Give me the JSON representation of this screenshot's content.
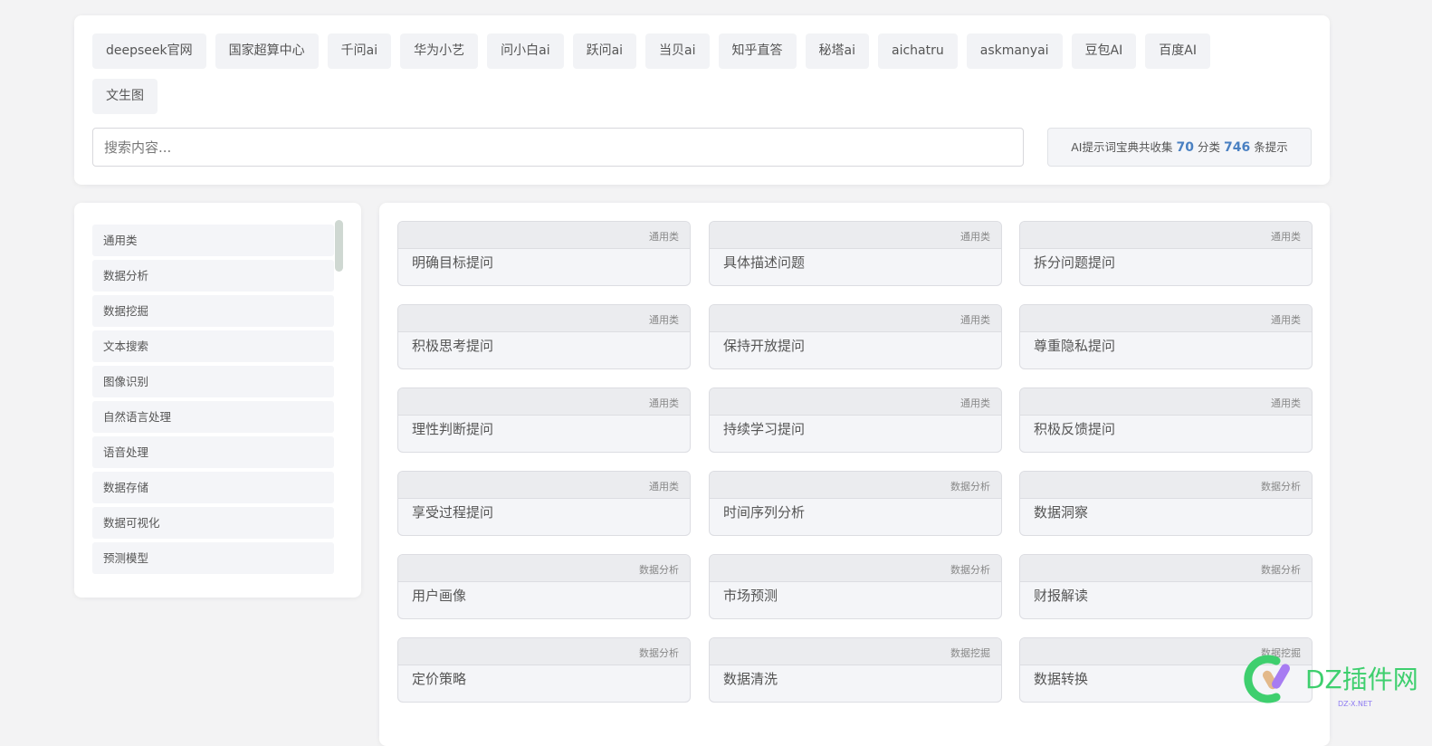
{
  "nav_tags": [
    "deepseek官网",
    "国家超算中心",
    "千问ai",
    "华为小艺",
    "问小白ai",
    "跃问ai",
    "当贝ai",
    "知乎直答",
    "秘塔ai",
    "aichatru",
    "askmanyai",
    "豆包AI",
    "百度AI",
    "文生图"
  ],
  "search": {
    "placeholder": "搜索内容..."
  },
  "stats": {
    "prefix": "AI提示词宝典共收集",
    "categories": "70",
    "mid": "分类",
    "prompts": "746",
    "suffix": "条提示"
  },
  "sidebar": [
    "通用类",
    "数据分析",
    "数据挖掘",
    "文本搜索",
    "图像识别",
    "自然语言处理",
    "语音处理",
    "数据存储",
    "数据可视化",
    "预测模型"
  ],
  "prompts": [
    {
      "cat": "通用类",
      "title": "明确目标提问"
    },
    {
      "cat": "通用类",
      "title": "具体描述问题"
    },
    {
      "cat": "通用类",
      "title": "拆分问题提问"
    },
    {
      "cat": "通用类",
      "title": "积极思考提问"
    },
    {
      "cat": "通用类",
      "title": "保持开放提问"
    },
    {
      "cat": "通用类",
      "title": "尊重隐私提问"
    },
    {
      "cat": "通用类",
      "title": "理性判断提问"
    },
    {
      "cat": "通用类",
      "title": "持续学习提问"
    },
    {
      "cat": "通用类",
      "title": "积极反馈提问"
    },
    {
      "cat": "通用类",
      "title": "享受过程提问"
    },
    {
      "cat": "数据分析",
      "title": "时间序列分析"
    },
    {
      "cat": "数据分析",
      "title": "数据洞察"
    },
    {
      "cat": "数据分析",
      "title": "用户画像"
    },
    {
      "cat": "数据分析",
      "title": "市场预测"
    },
    {
      "cat": "数据分析",
      "title": "财报解读"
    },
    {
      "cat": "数据分析",
      "title": "定价策略"
    },
    {
      "cat": "数据挖掘",
      "title": "数据清洗"
    },
    {
      "cat": "数据挖掘",
      "title": "数据转换"
    }
  ],
  "watermark": {
    "text": "DZ插件网",
    "sub": "DZ-X.NET"
  },
  "colors": {
    "accent": "#4a80c2"
  }
}
